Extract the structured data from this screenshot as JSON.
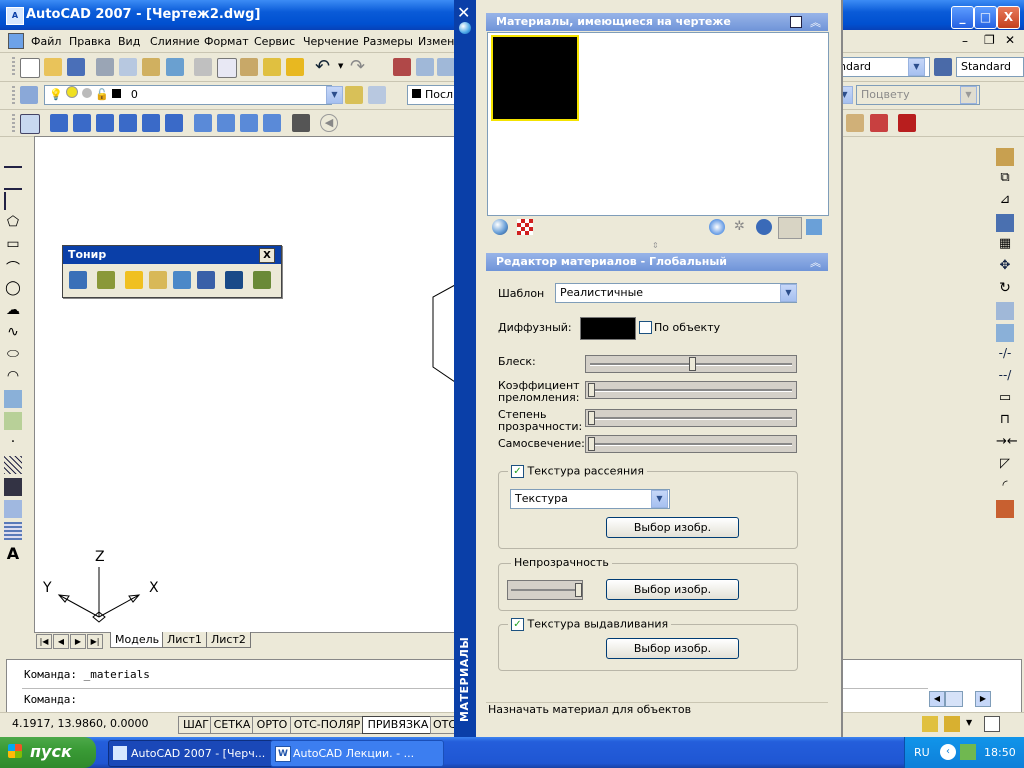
{
  "window": {
    "title": "AutoCAD 2007 - [Чертеж2.dwg]",
    "min": "_",
    "max": "□",
    "close": "X"
  },
  "menu": [
    "Файл",
    "Правка",
    "Вид",
    "Слияние",
    "Формат",
    "Сервис",
    "Черчение",
    "Размеры",
    "Измен"
  ],
  "toolbar": {
    "layer_value": "0",
    "linetype_value": "Посл",
    "dimstyle_value": "ndard",
    "textstyle_value": "Standard",
    "plot_value": "Поцвету"
  },
  "tonir": {
    "title": "Тонир",
    "close": "X"
  },
  "ucs": {
    "x": "X",
    "y": "Y",
    "z": "Z"
  },
  "tabs": [
    "Модель",
    "Лист1",
    "Лист2"
  ],
  "command": {
    "line1": "Команда:  _materials",
    "line2": "Команда:"
  },
  "status": {
    "coords": "4.1917, 13.9860, 0.0000",
    "buttons": [
      "ШАГ",
      "СЕТКА",
      "ОРТО",
      "ОТС-ПОЛЯР",
      "ПРИВЯЗКА",
      "ОТС"
    ],
    "active_index": 4
  },
  "taskbar": {
    "start": "пуск",
    "tasks": [
      "AutoCAD 2007 - [Черч...",
      "AutoCAD Лекции. - ..."
    ],
    "lang": "RU",
    "time": "18:50"
  },
  "palette": {
    "strip_label": "МАТЕРИАЛЫ",
    "available_header": "Материалы, имеющиеся на чертеже",
    "editor_header": "Редактор материалов - Глобальный",
    "template_label": "Шаблон",
    "template_value": "Реалистичные",
    "diffuse_label": "Диффузный:",
    "by_object_label": "По объекту",
    "sliders": [
      {
        "label": "Блеск:",
        "value": 0.5
      },
      {
        "label": "Коэффициент преломления:",
        "value": 0.0
      },
      {
        "label": "Степень прозрачности:",
        "value": 0.0
      },
      {
        "label": "Самосвечение:",
        "value": 0.0
      }
    ],
    "diffuse_map_label": "Текстура рассеяния",
    "diffuse_map_type": "Текстура",
    "select_image": "Выбор изобр.",
    "opacity_label": "Непрозрачность",
    "opacity_value": 1.0,
    "bump_label": "Текстура выдавливания",
    "apply_hint": "Назначать материал для объектов",
    "colors": {
      "swatch": "#000000",
      "swatch_border": "#f4e300",
      "header": "#0a3fa8"
    }
  }
}
